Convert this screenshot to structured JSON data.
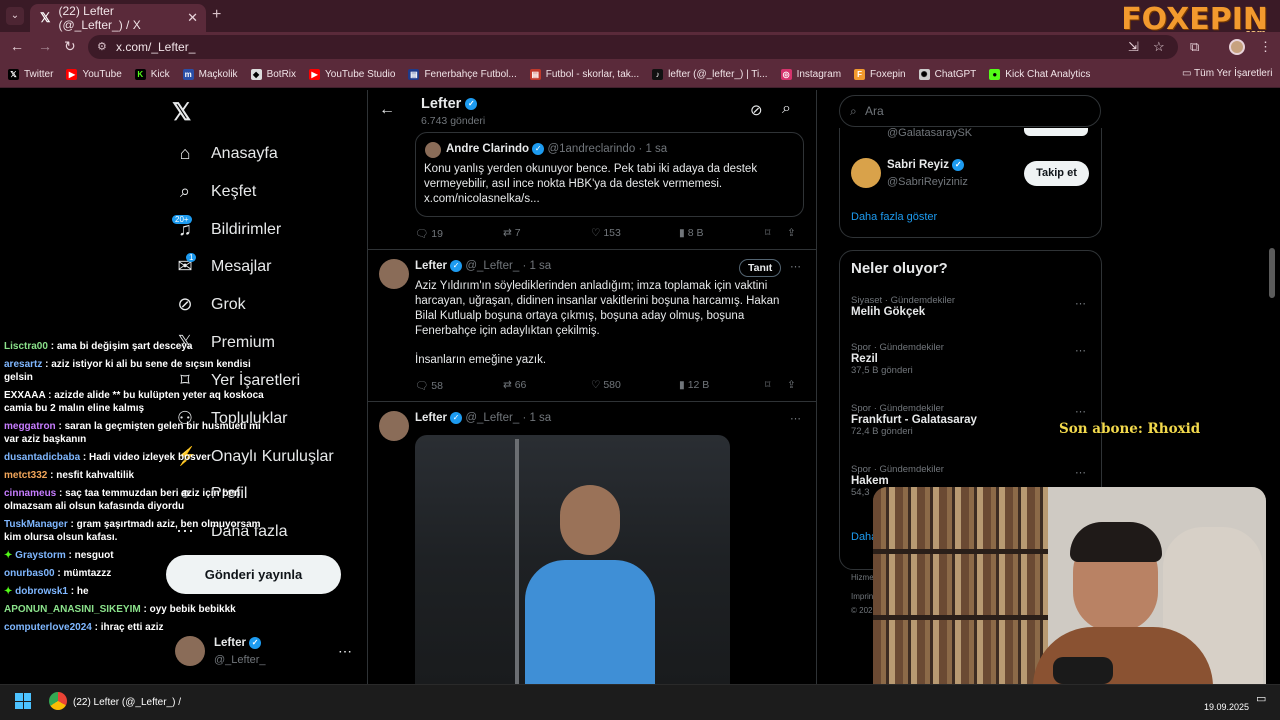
{
  "browser": {
    "tab_title": "(22) Lefter (@_Lefter_) / X",
    "url": "x.com/_Lefter_",
    "overlay_logo": "FOXEPIN",
    "overlay_logo_sub": ".com",
    "bookmarks": [
      {
        "label": "Twitter",
        "icon": "x-icon",
        "color": "#000000"
      },
      {
        "label": "YouTube",
        "icon": "youtube-icon",
        "color": "#ff0000"
      },
      {
        "label": "Kick",
        "icon": "kick-icon",
        "color": "#53fc18"
      },
      {
        "label": "Maçkolik",
        "icon": "mackolik-icon",
        "color": "#2a4fa8"
      },
      {
        "label": "BotRix",
        "icon": "botrix-icon",
        "color": "#cccccc"
      },
      {
        "label": "YouTube Studio",
        "icon": "youtube-studio-icon",
        "color": "#ff0000"
      },
      {
        "label": "Fenerbahçe Futbol...",
        "icon": "fenerbahce-icon",
        "color": "#1e3a8a"
      },
      {
        "label": "Futbol - skorlar, tak...",
        "icon": "flashscore-icon",
        "color": "#c0392b"
      },
      {
        "label": "lefter (@_lefter_) | Ti...",
        "icon": "tiktok-icon",
        "color": "#111111"
      },
      {
        "label": "Instagram",
        "icon": "instagram-icon",
        "color": "#d6336c"
      },
      {
        "label": "Foxepin",
        "icon": "foxepin-icon",
        "color": "#f29a2e"
      },
      {
        "label": "ChatGPT",
        "icon": "chatgpt-icon",
        "color": "#cccccc"
      },
      {
        "label": "Kick Chat Analytics",
        "icon": "kick-chat-icon",
        "color": "#53fc18"
      }
    ],
    "all_bookmarks": "Tüm Yer İşaretleri"
  },
  "nav": {
    "items": [
      {
        "label": "Anasayfa",
        "icon": "home-icon"
      },
      {
        "label": "Keşfet",
        "icon": "search-icon"
      },
      {
        "label": "Bildirimler",
        "icon": "bell-icon",
        "badge": "20+"
      },
      {
        "label": "Mesajlar",
        "icon": "mail-icon",
        "badge": "1"
      },
      {
        "label": "Grok",
        "icon": "grok-icon"
      },
      {
        "label": "Premium",
        "icon": "x-icon"
      },
      {
        "label": "Yer İşaretleri",
        "icon": "bookmark-icon"
      },
      {
        "label": "Topluluklar",
        "icon": "communities-icon"
      },
      {
        "label": "Onaylı Kuruluşlar",
        "icon": "verified-org-icon"
      },
      {
        "label": "Profil",
        "icon": "person-icon"
      },
      {
        "label": "Daha fazla",
        "icon": "more-icon"
      }
    ],
    "post_button": "Gönderi yayınla",
    "account_name": "Lefter",
    "account_handle": "@_Lefter_"
  },
  "chat": [
    {
      "user": "Lisctra00",
      "text": "ama bi değişim şart desceya",
      "color": "#8be28b"
    },
    {
      "user": "aresartz",
      "text": "aziz istiyor ki ali bu sene de sıçsın kendisi gelsin",
      "color": "#7fb7ff"
    },
    {
      "user": "EXXAAA",
      "text": "azizde alide ** bu kulüpten yeter aq koskoca camia bu 2 malın eline kalmış",
      "color": "#ffffff"
    },
    {
      "user": "meggatron",
      "text": "saran la geçmişten gelen bir husmueti mi var aziz başkanın",
      "color": "#c77dff"
    },
    {
      "user": "dusantadicbaba",
      "text": "Hadi video izleyek bosver",
      "color": "#7fb7ff"
    },
    {
      "user": "metct332",
      "text": "nesfit kahvaltilik",
      "color": "#f2a65a"
    },
    {
      "user": "cinnameus",
      "text": "saç taa temmuzdan beri aziz için ben olmazsam ali olsun kafasında diyordu",
      "color": "#c77dff"
    },
    {
      "user": "TuskManager",
      "text": "gram şaşırtmadı aziz, ben olmuyorsam kim olursa olsun kafası.",
      "color": "#7fb7ff"
    },
    {
      "user": "Graystorm",
      "text": "nesguot",
      "color": "#7fb7ff",
      "badge": true
    },
    {
      "user": "onurbas00",
      "text": "mümtazzz",
      "color": "#7fb7ff"
    },
    {
      "user": "dobrowsk1",
      "text": "he",
      "color": "#7fb7ff",
      "badge": true
    },
    {
      "user": "APONUN_ANASINI_SIKEYIM",
      "text": "oyy bebik bebikkk",
      "color": "#8be28b"
    },
    {
      "user": "computerlove2024",
      "text": "ihraç etti aziz",
      "color": "#7fb7ff"
    }
  ],
  "profile_header": {
    "name": "Lefter",
    "posts": "6.743 gönderi"
  },
  "quoted": {
    "name": "Andre Clarindo",
    "handle": "@1andreclarindo",
    "time": "· 1 sa",
    "text": "Konu yanlış yerden okunuyor bence. Pek tabi iki adaya da destek vermeyebilir, asıl ince nokta HBK'ya da destek vermemesi. x.com/nicolasnelka/s...",
    "replies": "19",
    "retweets": "7",
    "likes": "153",
    "views": "8 B"
  },
  "tweet1": {
    "name": "Lefter",
    "handle": "@_Lefter_",
    "time": "· 1 sa",
    "tag": "Tanıt",
    "text": "Aziz Yıldırım'ın söylediklerinden anladığım; imza toplamak için vaktini harcayan, uğraşan, didinen insanlar vakitlerini boşuna harcamış. Hakan Bilal Kutlualp boşuna ortaya çıkmış, boşuna aday olmuş, boşuna Fenerbahçe için adaylıktan çekilmiş.",
    "text2": "İnsanların emeğine yazık.",
    "replies": "58",
    "retweets": "66",
    "likes": "580",
    "views": "12 B"
  },
  "tweet2": {
    "name": "Lefter",
    "handle": "@_Lefter_",
    "time": "· 1 sa"
  },
  "sidebar": {
    "search_placeholder": "Ara",
    "who_to_follow": [
      {
        "name": "",
        "handle": "@GalatasaraySK"
      },
      {
        "name": "Sabri Reyiz",
        "handle": "@SabriReyiziniz",
        "button": "Takip et"
      }
    ],
    "show_more": "Daha fazla göster",
    "trends_title": "Neler oluyor?",
    "trends": [
      {
        "meta": "Siyaset · Gündemdekiler",
        "name": "Melih Gökçek",
        "count": ""
      },
      {
        "meta": "Spor · Gündemdekiler",
        "name": "Rezil",
        "count": "37,5 B gönderi"
      },
      {
        "meta": "Spor · Gündemdekiler",
        "name": "Frankfurt - Galatasaray",
        "count": "72,4 B gönderi"
      },
      {
        "meta": "Spor · Gündemdekiler",
        "name": "Hakem",
        "count": "54,3"
      }
    ],
    "trends_more": "Daha",
    "footer1": "Hizme",
    "footer2": "Imprin",
    "footer3": "© 202"
  },
  "stream": {
    "sub_alert": "Son abone: Rhoxid"
  },
  "taskbar": {
    "window_title": "(22) Lefter (@_Lefter_) /",
    "date": "19.09.2025"
  },
  "colors": {
    "accent": "#1d9bf0",
    "browser_frame": "#5a2a3a"
  }
}
